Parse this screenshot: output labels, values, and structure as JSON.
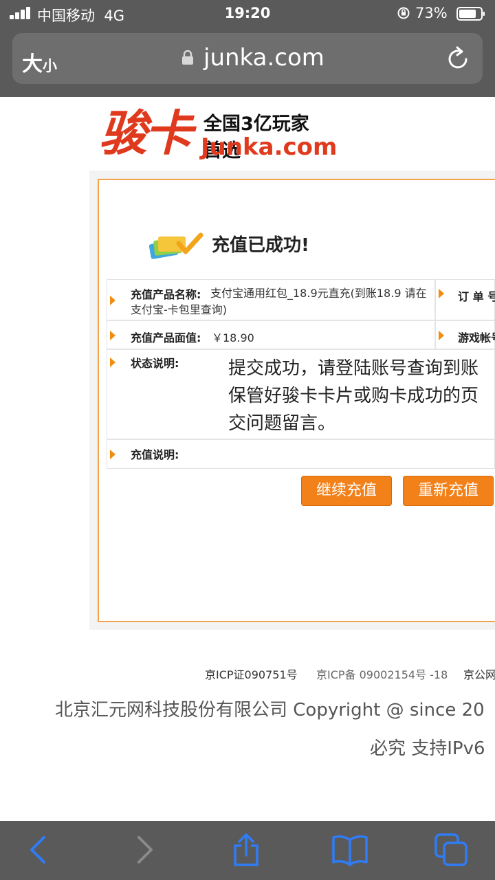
{
  "status_bar": {
    "carrier": "中国移动",
    "network": "4G",
    "time": "19:20",
    "battery": "73%"
  },
  "browser": {
    "text_size_label_big": "大",
    "text_size_label_small": "小",
    "url": "junka.com"
  },
  "logo": {
    "brand": "骏卡",
    "slogan": "全国3亿玩家首选",
    "domain": "Junka.com"
  },
  "result": {
    "title": "充值已成功!",
    "rows": {
      "product_name_label": "充值产品名称:",
      "product_name_value": "支付宝通用红包_18.9元直充(到账18.9 请在支付宝-卡包里查询)",
      "order_label": "订 单 号",
      "face_value_label": "充值产品面值:",
      "face_value_value": "￥18.90",
      "game_account_label": "游戏帐号",
      "status_label": "状态说明:",
      "status_value_line1": "提交成功，请登陆账号查询到账",
      "status_value_line2": "保管好骏卡卡片或购卡成功的页",
      "status_value_line3": "交问题留言。",
      "note_label": "充值说明:"
    },
    "buttons": {
      "continue": "继续充值",
      "retry": "重新充值"
    }
  },
  "footer": {
    "icp1": "京ICP证090751号",
    "icp2": "京ICP备 09002154号 -18",
    "icp3": "京公网",
    "company": "北京汇元网科技股份有限公司 Copyright @ since 20",
    "line2": "必究   支持IPv6"
  },
  "colors": {
    "accent_orange": "#f2811a",
    "logo_red": "#e03a1e",
    "chrome_gray": "#5a5a5a",
    "ios_blue": "#2f7cf6"
  }
}
